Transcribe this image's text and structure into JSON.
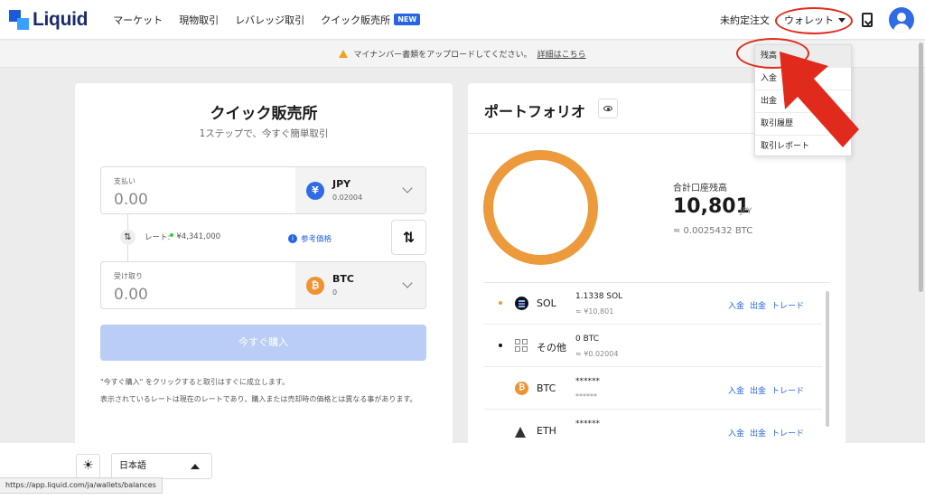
{
  "header": {
    "logo_text": "Liquid",
    "nav": [
      {
        "label": "マーケット"
      },
      {
        "label": "現物取引"
      },
      {
        "label": "レバレッジ取引"
      },
      {
        "label": "クイック販売所",
        "badge": "NEW"
      }
    ],
    "open_orders": "未約定注文",
    "wallet": "ウォレット"
  },
  "notice": {
    "text": "マイナンバー書類をアップロードしてください。",
    "link": "詳細はこちら"
  },
  "wallet_menu": {
    "items": [
      {
        "label": "残高"
      },
      {
        "label": "入金"
      },
      {
        "label": "出金"
      },
      {
        "label": "取引履歴"
      },
      {
        "label": "取引レポート"
      }
    ]
  },
  "quick": {
    "title": "クイック販売所",
    "subtitle": "1ステップで、今すぐ簡単取引",
    "pay": {
      "label": "支払い",
      "value": "0.00",
      "coin": "JPY",
      "coin_amount": "0.02004",
      "icon_glyph": "¥"
    },
    "rate_label": "レート:",
    "rate_value": "¥4,341,000",
    "ref_price": "参考価格",
    "receive": {
      "label": "受け取り",
      "value": "0.00",
      "coin": "BTC",
      "coin_amount": "0",
      "icon_glyph": "₿"
    },
    "buy_button": "今すぐ購入",
    "note1": "\"今すぐ購入\" をクリックすると取引はすぐに成立します。",
    "note2": "表示されているレートは現在のレートであり、購入または売却時の価格とは異なる事があります。"
  },
  "portfolio": {
    "title": "ポートフォリオ",
    "total_label": "合計口座残高",
    "total_value": "10,801",
    "total_unit": "JPY",
    "total_btc": "≈ 0.0025432 BTC",
    "assets": [
      {
        "name": "SOL",
        "balance": "1.1338 SOL",
        "jpy": "≈ ¥10,801",
        "actions": [
          "入金",
          "出金",
          "トレード"
        ],
        "dot_color": "#ec9a3c"
      },
      {
        "name": "その他",
        "balance": "0 BTC",
        "jpy": "≈ ¥0.02004",
        "actions": [],
        "dot_color": "#111111"
      },
      {
        "name": "BTC",
        "balance": "******",
        "jpy": "******",
        "actions": [
          "入金",
          "出金",
          "トレード"
        ],
        "dot_color": ""
      },
      {
        "name": "ETH",
        "balance": "******",
        "jpy": "",
        "actions": [
          "入金",
          "出金",
          "トレード"
        ],
        "dot_color": ""
      }
    ],
    "ring_color": "#ec9a3c"
  },
  "footer": {
    "theme_icon": "sun-icon",
    "language": "日本語"
  },
  "status_url": "https://app.liquid.com/ja/wallets/balances",
  "colors": {
    "accent": "#2763e6",
    "annotation_red": "#e02a1c",
    "buy_disabled": "#b9cdf6"
  }
}
